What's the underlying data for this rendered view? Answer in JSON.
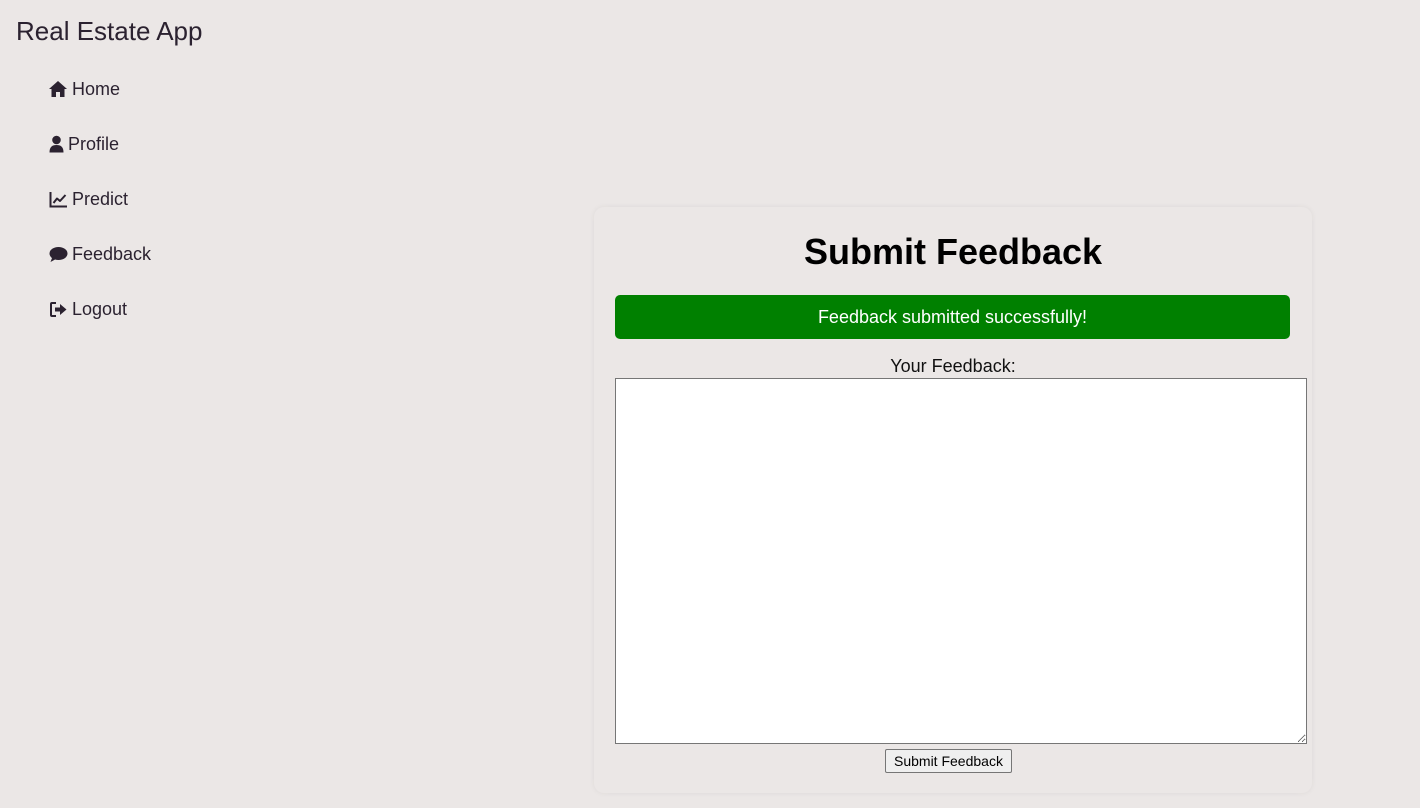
{
  "app": {
    "title": "Real Estate App"
  },
  "sidebar": {
    "items": [
      {
        "label": "Home",
        "icon": "home-icon"
      },
      {
        "label": "Profile",
        "icon": "user-icon"
      },
      {
        "label": "Predict",
        "icon": "chart-line-icon"
      },
      {
        "label": "Feedback",
        "icon": "comment-icon"
      },
      {
        "label": "Logout",
        "icon": "sign-out-icon"
      }
    ]
  },
  "feedback_form": {
    "title": "Submit Feedback",
    "success_message": "Feedback submitted successfully!",
    "label": "Your Feedback:",
    "textarea_value": "",
    "submit_label": "Submit Feedback"
  },
  "colors": {
    "background": "#ebe7e6",
    "text": "#2b2230",
    "success": "#008000"
  }
}
